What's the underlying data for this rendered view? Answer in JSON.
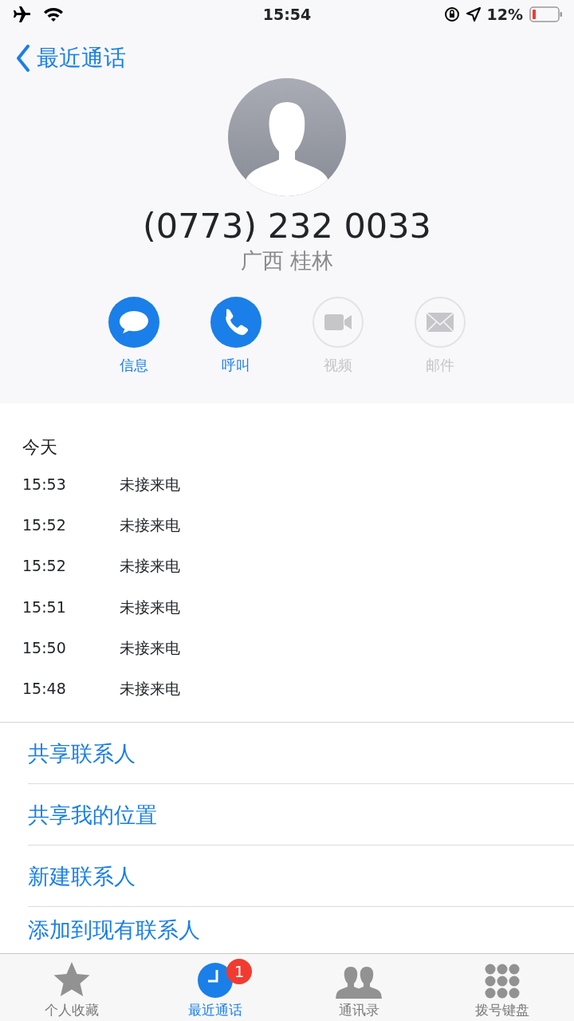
{
  "status_bar": {
    "time": "15:54",
    "battery": "12%"
  },
  "nav": {
    "back": "最近通话"
  },
  "contact": {
    "number": "(0773) 232 0033",
    "location": "广西 桂林"
  },
  "actions": [
    {
      "kind": "message",
      "label": "信息",
      "disabled": false
    },
    {
      "kind": "call",
      "label": "呼叫",
      "disabled": false
    },
    {
      "kind": "video",
      "label": "视频",
      "disabled": true
    },
    {
      "kind": "mail",
      "label": "邮件",
      "disabled": true
    }
  ],
  "history": {
    "heading": "今天",
    "calls": [
      {
        "time": "15:53",
        "type": "未接来电"
      },
      {
        "time": "15:52",
        "type": "未接来电"
      },
      {
        "time": "15:52",
        "type": "未接来电"
      },
      {
        "time": "15:51",
        "type": "未接来电"
      },
      {
        "time": "15:50",
        "type": "未接来电"
      },
      {
        "time": "15:48",
        "type": "未接来电"
      }
    ]
  },
  "links": [
    "共享联系人",
    "共享我的位置",
    "新建联系人",
    "添加到现有联系人"
  ],
  "tabs": [
    {
      "kind": "favorites",
      "label": "个人收藏",
      "selected": false
    },
    {
      "kind": "recents",
      "label": "最近通话",
      "selected": true,
      "badge": "1"
    },
    {
      "kind": "contacts",
      "label": "通讯录",
      "selected": false
    },
    {
      "kind": "keypad",
      "label": "拨号键盘",
      "selected": false
    }
  ]
}
